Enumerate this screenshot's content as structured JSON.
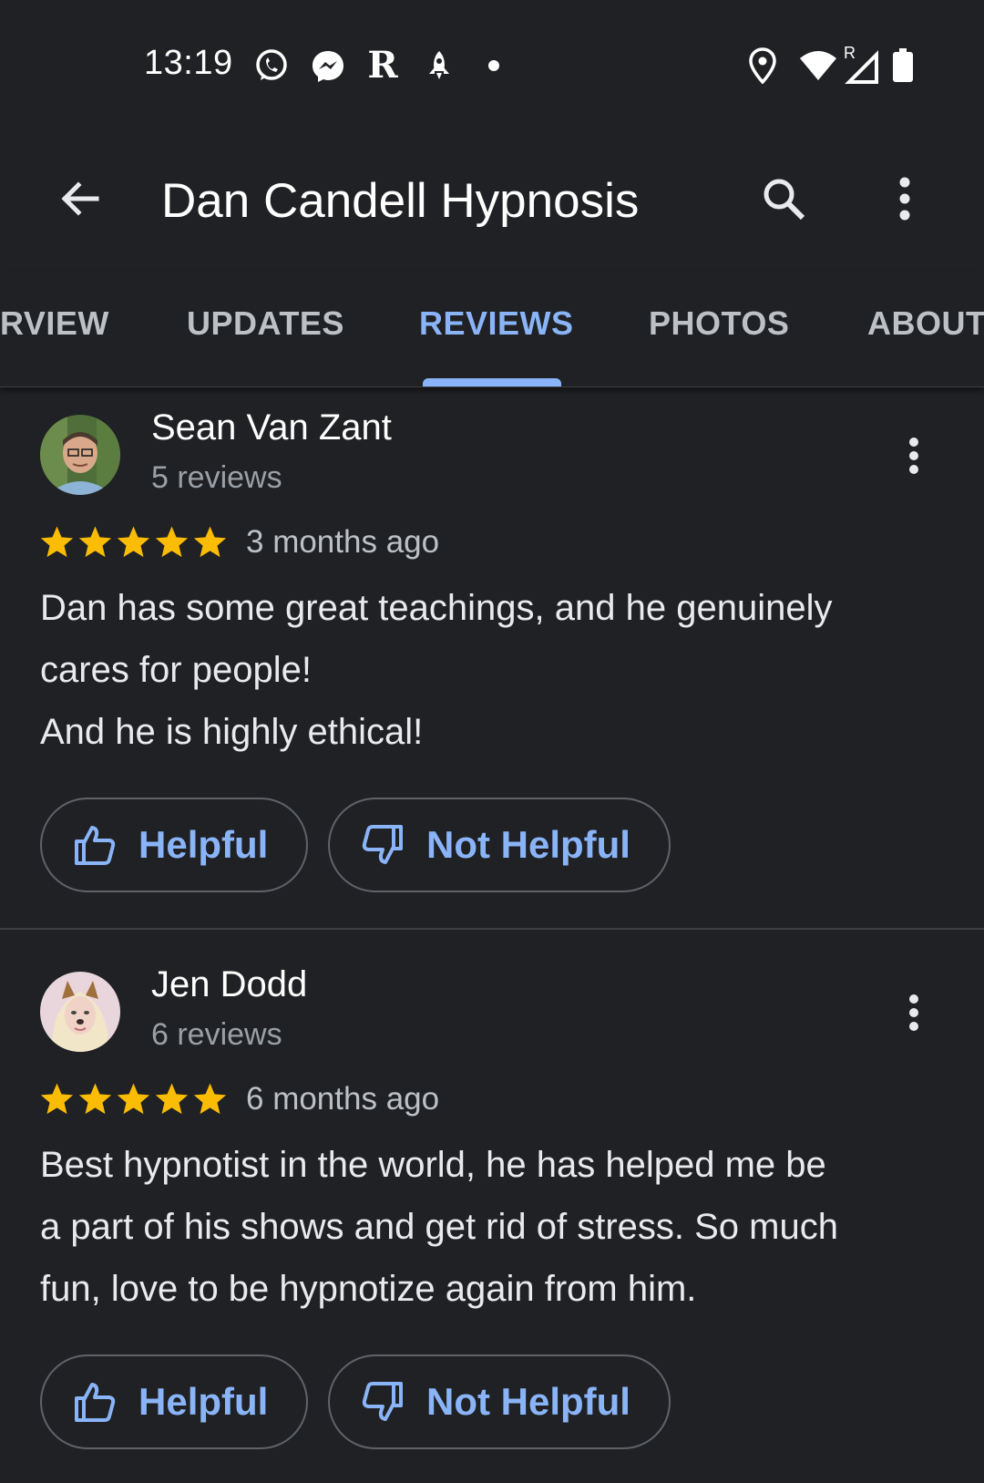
{
  "status_bar": {
    "time": "13:19",
    "left_icons": [
      "whatsapp-icon",
      "messenger-icon",
      "r-app-icon",
      "rocket-icon",
      "dot-icon"
    ],
    "r_app_glyph": "R",
    "right_icons": [
      "location-icon",
      "wifi-icon",
      "signal-icon",
      "battery-icon"
    ],
    "roaming_indicator": "R"
  },
  "app_bar": {
    "title": "Dan Candell Hypnosis"
  },
  "tabs": [
    {
      "label": "RVIEW"
    },
    {
      "label": "UPDATES"
    },
    {
      "label": "REVIEWS",
      "active": true
    },
    {
      "label": "PHOTOS"
    },
    {
      "label": "ABOUT"
    }
  ],
  "reviews": [
    {
      "name": "Sean Van Zant",
      "review_count": "5 reviews",
      "rating": 5,
      "date": "3 months ago",
      "text_lines": [
        "Dan has some great teachings, and he genuinely",
        "cares for people!",
        "And he is highly ethical!"
      ],
      "helpful_label": "Helpful",
      "not_helpful_label": "Not Helpful"
    },
    {
      "name": "Jen Dodd",
      "review_count": "6 reviews",
      "rating": 5,
      "date": "6 months ago",
      "text_lines": [
        "Best hypnotist in the world, he has helped me be",
        "a part of his shows and get rid of stress. So much",
        "fun, love to be hypnotize again from him."
      ],
      "helpful_label": "Helpful",
      "not_helpful_label": "Not Helpful"
    }
  ],
  "colors": {
    "background": "#202124",
    "accent": "#8ab4f8",
    "star": "#fbbc04",
    "secondary_text": "#9aa0a6"
  }
}
